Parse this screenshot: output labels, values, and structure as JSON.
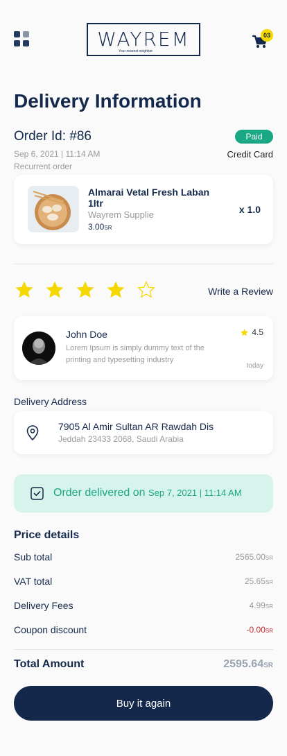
{
  "header": {
    "logo_text": "WAYREM",
    "logo_tagline": "Your nearest neighbor",
    "cart_count": "03"
  },
  "page_title": "Delivery Information",
  "order": {
    "id_label": "Order Id: #86",
    "status": "Paid",
    "date": "Sep 6, 2021 | 11:14 AM",
    "payment_method": "Credit Card",
    "type": "Recurrent order"
  },
  "product": {
    "name": "Almarai Vetal Fresh Laban 1ltr",
    "supplier": "Wayrem Supplie",
    "price": "3.00",
    "currency": "SR",
    "quantity": "x 1.0"
  },
  "rating": {
    "stars_filled": 4,
    "stars_total": 5,
    "write_review_label": "Write a Review"
  },
  "review": {
    "name": "John Doe",
    "text": "Lorem Ipsum is simply dummy text of the printing and typesetting industry",
    "rating": "4.5",
    "time": "today"
  },
  "delivery_address": {
    "label": "Delivery Address",
    "line1": "7905 Al Amir Sultan AR Rawdah Dis",
    "line2": "Jeddah 23433 2068, Saudi Arabia"
  },
  "delivered": {
    "text": "Order delivered on",
    "date": "Sep 7, 2021 | 11:14 AM"
  },
  "price_details": {
    "title": "Price details",
    "subtotal_label": "Sub total",
    "subtotal": "2565.00",
    "vat_label": "VAT total",
    "vat": "25.65",
    "delivery_label": "Delivery Fees",
    "delivery": "4.99",
    "coupon_label": "Coupon discount",
    "coupon": "-0.00",
    "currency": "SR",
    "total_label": "Total Amount",
    "total": "2595.64"
  },
  "buy_again_label": "Buy it again",
  "colors": {
    "navy": "#14284b",
    "green": "#1aa884",
    "star": "#f5d800",
    "discount_red": "#c0262d"
  }
}
